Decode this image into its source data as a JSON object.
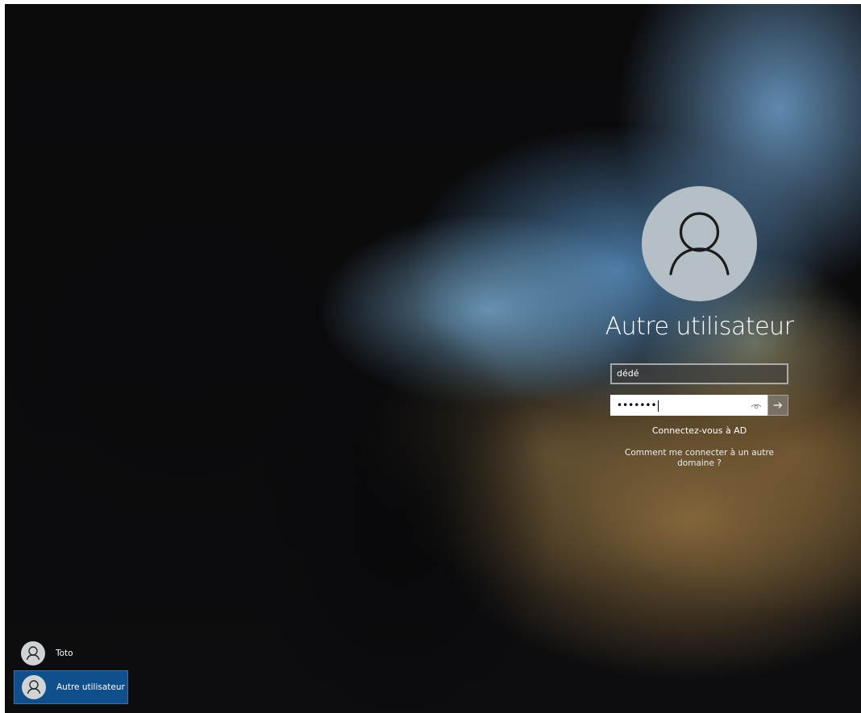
{
  "login": {
    "display_name": "Autre utilisateur",
    "username_value": "dédé",
    "password_masked": "•••••••",
    "link_connect": "Connectez-vous à AD",
    "link_other_domain": "Comment me connecter à un autre domaine ?"
  },
  "users": [
    {
      "name": "Toto",
      "selected": false
    },
    {
      "name": "Autre utilisateur",
      "selected": true
    }
  ],
  "colors": {
    "selected_user_bg": "#0f4f8c",
    "avatar_bg": "#b4bfc6"
  },
  "icons": {
    "avatar": "user-silhouette-icon",
    "reveal": "eye-icon",
    "submit": "arrow-right-icon"
  }
}
